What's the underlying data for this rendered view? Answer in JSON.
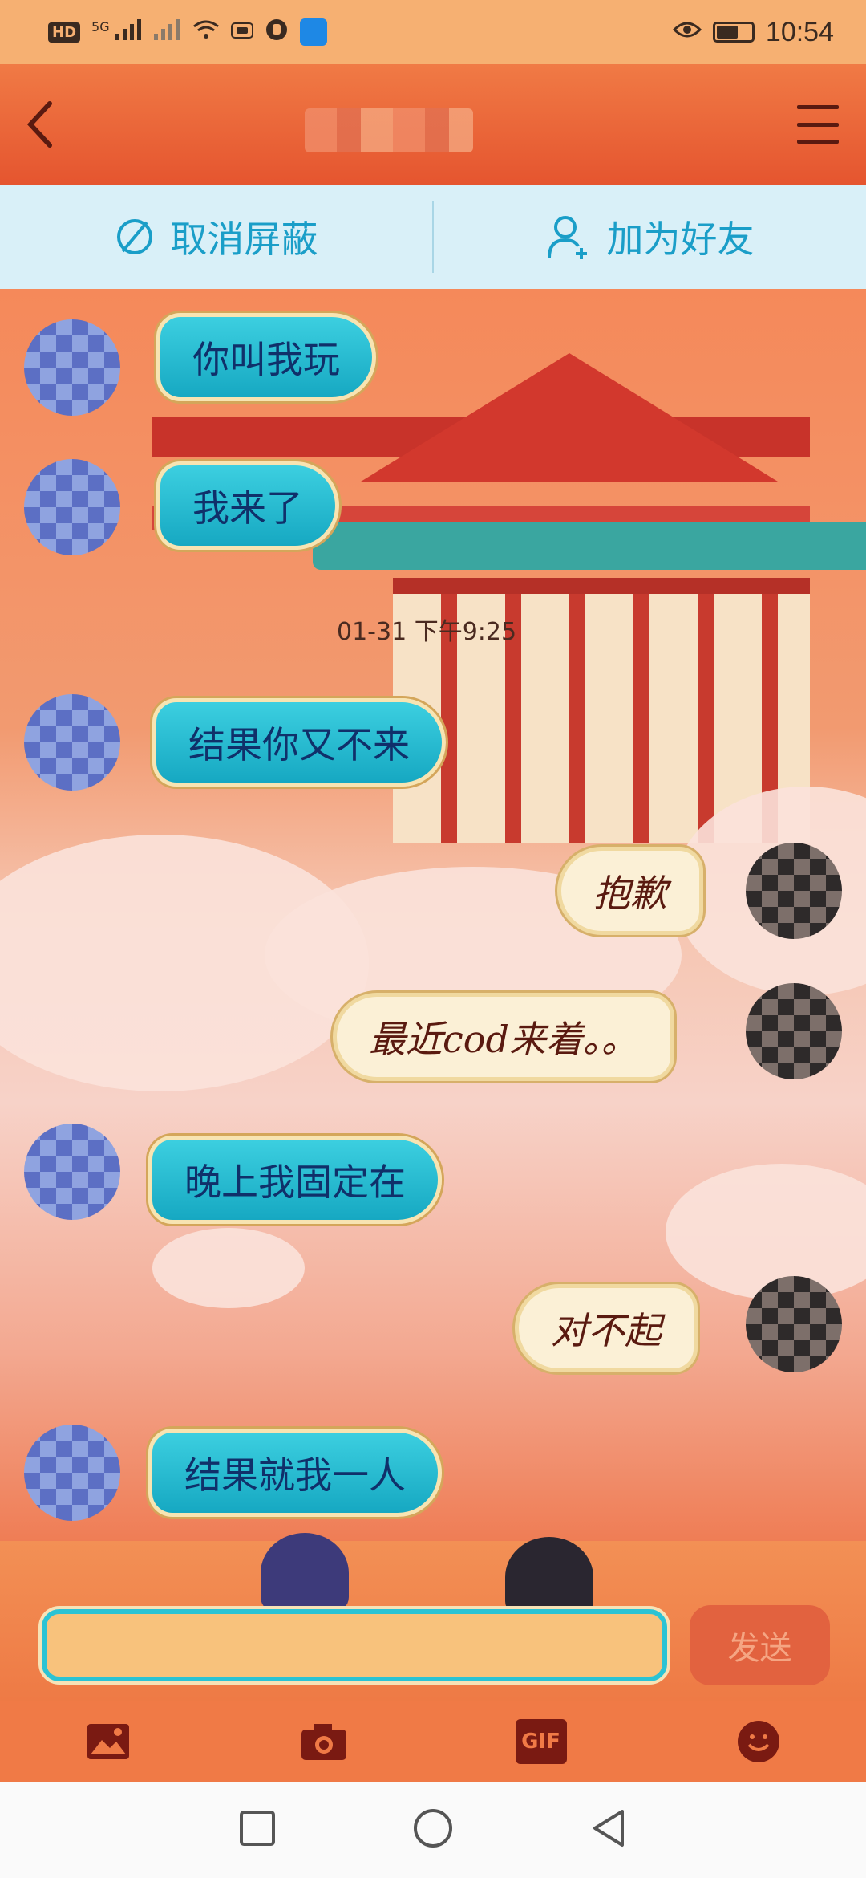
{
  "status_bar": {
    "time": "10:54",
    "network": "5G",
    "hd_badge": "HD",
    "icons": [
      "hd-badge-icon",
      "signal-5g-icon",
      "signal-x-icon",
      "wifi-icon",
      "nfc-icon",
      "hand-icon",
      "app-icon",
      "eye-icon",
      "battery-icon"
    ]
  },
  "header": {
    "back_icon": "chevron-left-icon",
    "menu_icon": "hamburger-menu-icon"
  },
  "actions": {
    "unblock_label": "取消屏蔽",
    "add_friend_label": "加为好友"
  },
  "messages": [
    {
      "side": "left",
      "text": "你叫我玩"
    },
    {
      "side": "left",
      "text": "我来了"
    },
    {
      "side": "left",
      "text": "结果你又不来"
    },
    {
      "side": "right",
      "text": "抱歉"
    },
    {
      "side": "right",
      "text": "最近cod来着。。"
    },
    {
      "side": "left",
      "text": "晚上我固定在"
    },
    {
      "side": "right",
      "text": "对不起"
    },
    {
      "side": "left",
      "text": "结果就我一人"
    }
  ],
  "timestamp": "01-31 下午9:25",
  "composer": {
    "input_value": "",
    "send_label": "发送"
  },
  "toolbar": {
    "items": [
      "image-icon",
      "camera-icon",
      "gif-icon",
      "emoji-icon"
    ],
    "gif_label": "GIF"
  },
  "nav": {
    "items": [
      "recents-square-icon",
      "home-circle-icon",
      "back-triangle-icon"
    ]
  }
}
